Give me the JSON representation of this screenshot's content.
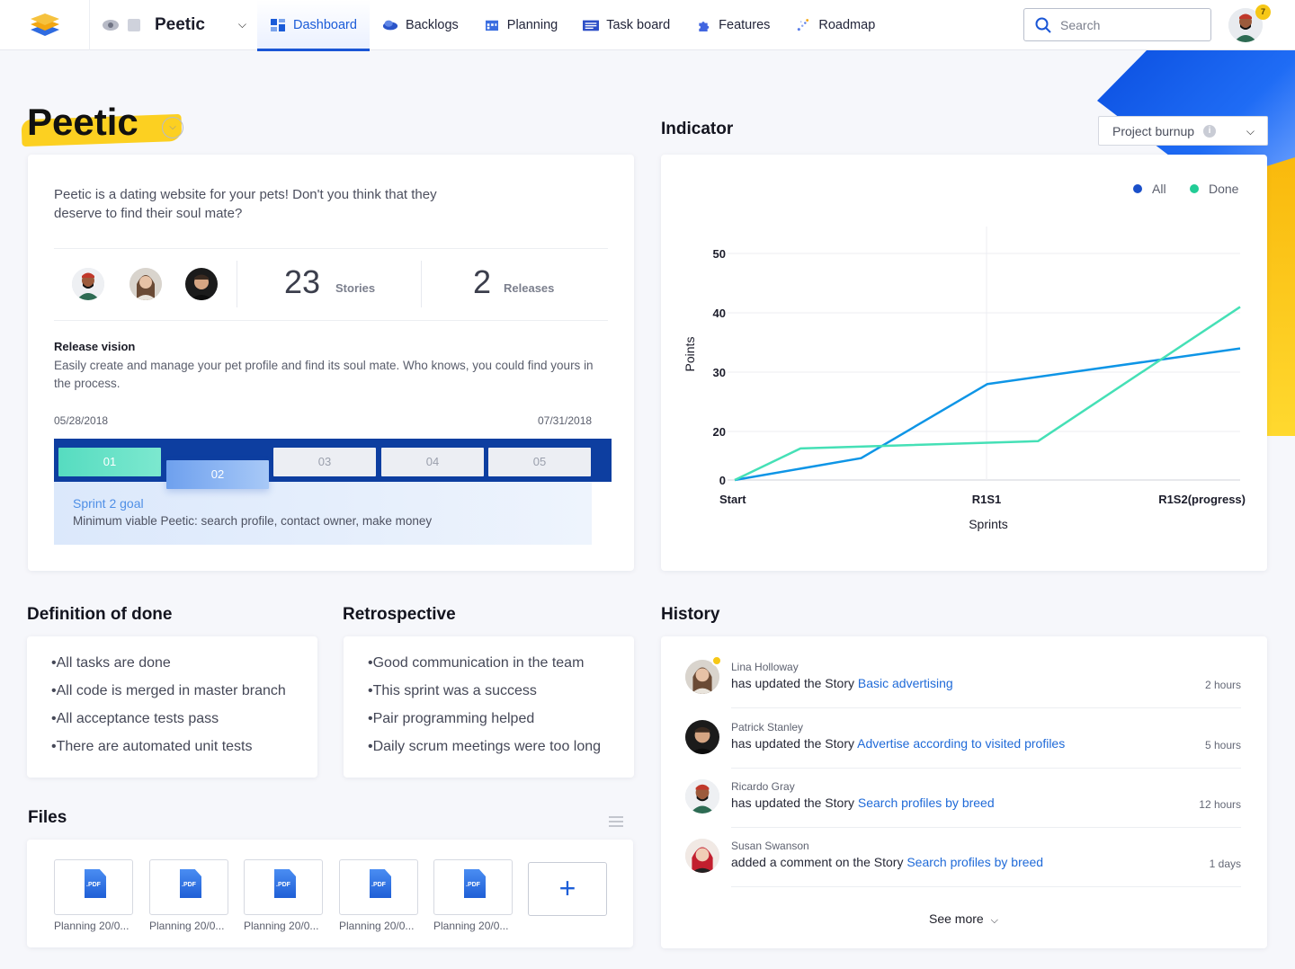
{
  "nav": {
    "project": "Peetic",
    "tabs": [
      {
        "label": "Dashboard",
        "icon": "dashboard-icon",
        "color": "#1a5bd8"
      },
      {
        "label": "Backlogs",
        "icon": "backlogs-icon",
        "color": "#2a54c9"
      },
      {
        "label": "Planning",
        "icon": "planning-icon",
        "color": "#3b6ee0"
      },
      {
        "label": "Task board",
        "icon": "taskboard-icon",
        "color": "#2d4fc7"
      },
      {
        "label": "Features",
        "icon": "features-icon",
        "color": "#4266e0"
      },
      {
        "label": "Roadmap",
        "icon": "roadmap-icon",
        "color": "#5a7de8"
      }
    ],
    "search_placeholder": "Search",
    "notification_count": "7"
  },
  "project": {
    "title": "Peetic",
    "description": "Peetic is a dating website for your pets! Don't you think that they deserve to find their soul mate?",
    "stories_count": "23",
    "stories_label": "Stories",
    "releases_count": "2",
    "releases_label": "Releases",
    "release_vision_title": "Release vision",
    "release_vision_text": "Easily create and manage your pet profile and find its soul mate. Who knows, you could find yours in the process.",
    "start_date": "05/28/2018",
    "end_date": "07/31/2018",
    "sprints": [
      "01",
      "02",
      "03",
      "04",
      "05"
    ],
    "sprint_goal_title": "Sprint 2 goal",
    "sprint_goal_text": "Minimum viable Peetic: search profile, contact owner, make money"
  },
  "indicator": {
    "title": "Indicator",
    "select_value": "Project burnup"
  },
  "chart_data": {
    "type": "line",
    "x": [
      "Start",
      "",
      "R1S1",
      "",
      "R1S2(progress)"
    ],
    "xlabel": "Sprints",
    "ylabel": "Points",
    "yticks": [
      0,
      20,
      30,
      40,
      50
    ],
    "ylim": [
      0,
      55
    ],
    "legend_position": "top-right",
    "series": [
      {
        "name": "All",
        "color": "#0e95e6",
        "points": [
          [
            0,
            0
          ],
          [
            0.25,
            9
          ],
          [
            0.5,
            28
          ],
          [
            1.0,
            34
          ]
        ]
      },
      {
        "name": "Done",
        "color": "#45e0b6",
        "points": [
          [
            0,
            0
          ],
          [
            0.13,
            13
          ],
          [
            0.6,
            16
          ],
          [
            1.0,
            41
          ]
        ]
      }
    ],
    "legend_colors": {
      "All": "#1a4fc9",
      "Done": "#22cc96"
    }
  },
  "dod": {
    "title": "Definition of done",
    "items": [
      "•All tasks are done",
      "•All code is merged in master branch",
      "•All acceptance tests pass",
      "•There are automated unit tests"
    ]
  },
  "retro": {
    "title": "Retrospective",
    "items": [
      "•Good communication in the team",
      "•This sprint was a success",
      "•Pair programming helped",
      "•Daily scrum meetings were too long"
    ]
  },
  "files": {
    "title": "Files",
    "items": [
      "Planning 20/0...",
      "Planning 20/0...",
      "Planning 20/0...",
      "Planning 20/0...",
      "Planning 20/0..."
    ],
    "badge": ".PDF"
  },
  "history": {
    "title": "History",
    "items": [
      {
        "name": "Lina Holloway",
        "action": "has updated the Story ",
        "link": "Basic advertising",
        "time": "2 hours"
      },
      {
        "name": "Patrick Stanley",
        "action": "has updated the Story ",
        "link": "Advertise according to visited profiles",
        "time": "5 hours"
      },
      {
        "name": "Ricardo Gray",
        "action": "has updated the Story ",
        "link": "Search profiles by breed",
        "time": "12 hours"
      },
      {
        "name": "Susan Swanson",
        "action": "added a comment on the Story ",
        "link": "Search profiles by breed",
        "time": "1 days"
      }
    ],
    "see_more": "See more"
  }
}
